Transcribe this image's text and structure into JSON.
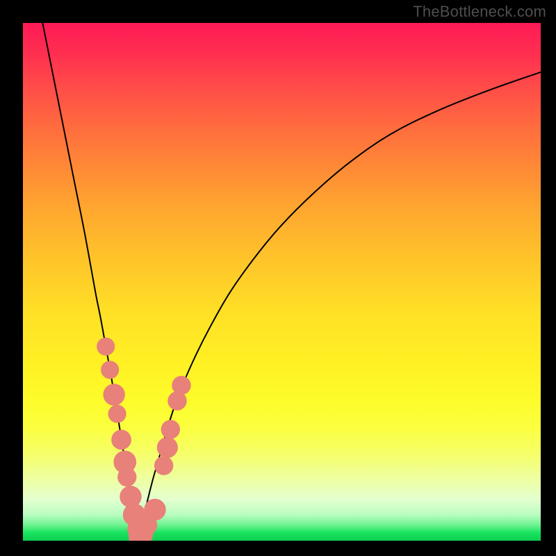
{
  "watermark": {
    "text": "TheBottleneck.com"
  },
  "colors": {
    "curve": "#000000",
    "marker_fill": "#e88179",
    "marker_stroke": "#d86e67",
    "frame": "#000000"
  },
  "chart_data": {
    "type": "line",
    "title": "",
    "xlabel": "",
    "ylabel": "",
    "xlim": [
      0,
      100
    ],
    "ylim": [
      0,
      100
    ],
    "grid": false,
    "legend": false,
    "description": "Two monotone curves descending from y=100 to y=0, meeting near x≈22 at y=0; left branch steep from top-left, right branch concave rising toward top-right. Vertical axis visually encodes bottleneck percentage (red high, green low).",
    "series": [
      {
        "name": "left-branch",
        "x": [
          3.8,
          6,
          8,
          10,
          12,
          14,
          15,
          16,
          17,
          18,
          18.8,
          19.6,
          20.3,
          21,
          21.5,
          22,
          22.3
        ],
        "y": [
          100,
          89,
          79,
          69,
          59,
          48,
          43,
          37.5,
          32,
          26,
          21,
          16,
          11.5,
          7.5,
          4.5,
          2,
          0.8
        ]
      },
      {
        "name": "right-branch",
        "x": [
          22.3,
          23,
          24,
          25,
          26,
          27,
          28,
          30,
          33,
          36,
          40,
          45,
          50,
          56,
          63,
          71,
          80,
          90,
          100
        ],
        "y": [
          0.8,
          3,
          7.5,
          11.5,
          15,
          18.5,
          22,
          28,
          35,
          41,
          48,
          55,
          61,
          67,
          73,
          78.5,
          83,
          87,
          90.5
        ]
      }
    ],
    "markers": {
      "name": "highlighted-points",
      "points": [
        {
          "x": 16.0,
          "y": 37.5,
          "r": 1.2
        },
        {
          "x": 16.8,
          "y": 33.0,
          "r": 1.2
        },
        {
          "x": 17.6,
          "y": 28.2,
          "r": 1.6
        },
        {
          "x": 18.2,
          "y": 24.5,
          "r": 1.2
        },
        {
          "x": 19.0,
          "y": 19.5,
          "r": 1.4
        },
        {
          "x": 19.7,
          "y": 15.2,
          "r": 1.7
        },
        {
          "x": 20.1,
          "y": 12.3,
          "r": 1.3
        },
        {
          "x": 20.8,
          "y": 8.5,
          "r": 1.6
        },
        {
          "x": 21.5,
          "y": 5.0,
          "r": 1.7
        },
        {
          "x": 22.1,
          "y": 2.2,
          "r": 1.4
        },
        {
          "x": 22.4,
          "y": 0.9,
          "r": 1.5
        },
        {
          "x": 23.2,
          "y": 1.2,
          "r": 1.4
        },
        {
          "x": 24.0,
          "y": 3.0,
          "r": 1.4
        },
        {
          "x": 25.5,
          "y": 6.0,
          "r": 1.6
        },
        {
          "x": 27.2,
          "y": 14.5,
          "r": 1.3
        },
        {
          "x": 27.9,
          "y": 18.0,
          "r": 1.5
        },
        {
          "x": 28.5,
          "y": 21.5,
          "r": 1.3
        },
        {
          "x": 29.8,
          "y": 27.0,
          "r": 1.3
        },
        {
          "x": 30.6,
          "y": 30.0,
          "r": 1.3
        }
      ]
    }
  }
}
